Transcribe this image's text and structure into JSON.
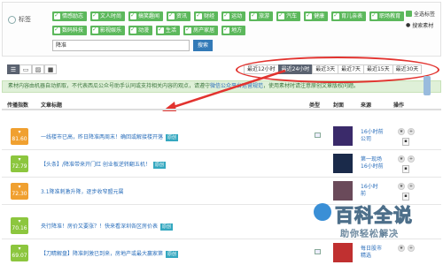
{
  "tag_panel": {
    "label": "标签",
    "tags": [
      "情感励志",
      "文人时尚",
      "搞笑趣闻",
      "资讯",
      "财经",
      "运动",
      "旅游",
      "汽车",
      "健康",
      "育儿亲表",
      "职场教育",
      "数码科技",
      "影视娱乐",
      "动漫",
      "生活",
      "房产家居",
      "地方"
    ],
    "select_all": "全选标签",
    "search_tip": "搜索素材",
    "search_value": "降准",
    "search_button": "搜索"
  },
  "time_filter": [
    "最近12小时",
    "最近24小时",
    "最近3天",
    "最近7天",
    "最近15天",
    "最近30天"
  ],
  "time_filter_active": 1,
  "notice": {
    "text": "素材内容由机器自动抓取，不代表西瓜公众号助手认同或支持相关内容的观点，请遵守",
    "link": "微信公众平台运营规范",
    "suffix": "，使用素材时请注意原创文章版权问题。"
  },
  "columns": {
    "index": "传播指数",
    "title": "文章标题",
    "type": "类型",
    "cover": "封面",
    "source": "来源",
    "ops": "操作"
  },
  "rows": [
    {
      "index": "81.60",
      "title": "一线楼市已高，昨日降准两周末！确回或解接楼开落",
      "orig": "原创",
      "source_line1": "16小时前",
      "source_line2": "公司"
    },
    {
      "index": "72.79",
      "title": "【头条】/降准带来开门红 创业板逆转翻五机！",
      "orig": "原创",
      "source_line1": "第一现场",
      "source_line2": "16小时前"
    },
    {
      "index": "72.30",
      "title": "3.1降准刺激升降，逐步收窄盟元属",
      "orig": "",
      "source_line1": "16小时",
      "source_line2": "前"
    },
    {
      "index": "70.16",
      "title": "央行降准！房价又要涨？！快来看深圳各区房价表",
      "orig": "原创",
      "source_line1": "16小时",
      "source_line2": "前"
    },
    {
      "index": "69.07",
      "title": "【刀睛解盘】降准刺激已到来，房地产或最大赢家第",
      "orig": "原创",
      "source_line1": "每日股市",
      "source_line2": "精选"
    }
  ],
  "watermark": {
    "title": "百科全说",
    "subtitle": "助你轻松解决"
  }
}
